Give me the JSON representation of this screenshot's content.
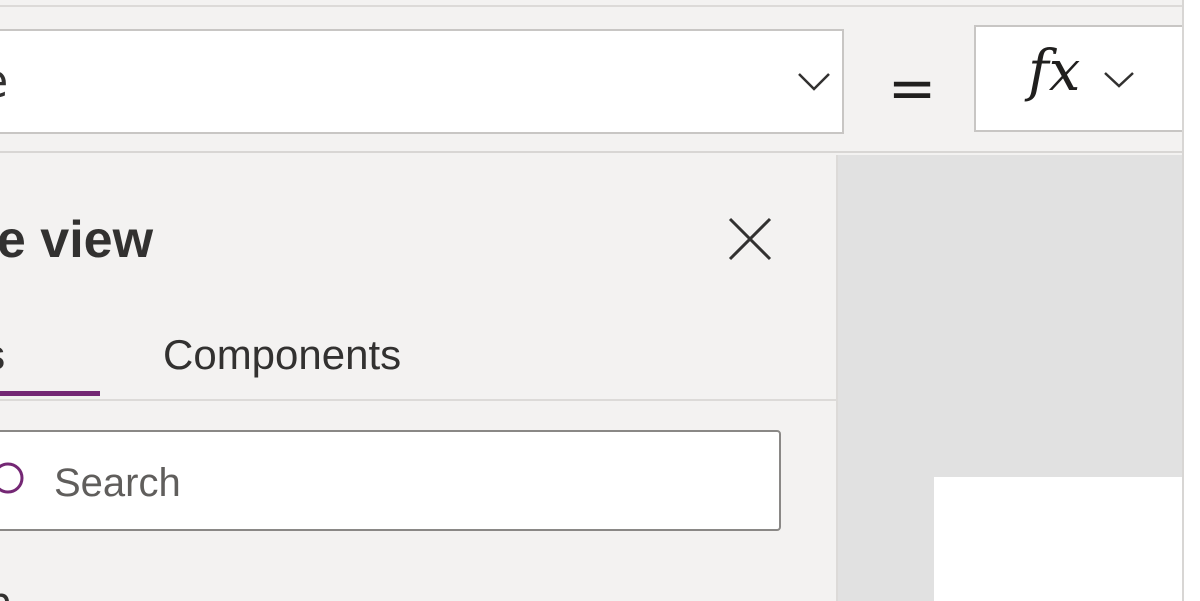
{
  "formula_bar": {
    "property_value": "e",
    "equals": "=",
    "fx_label": "fx",
    "dropdown_icon": "chevron-down-icon",
    "fx_icon": "chevron-down-icon"
  },
  "tree_view": {
    "title": "ee view",
    "close_icon": "close-icon",
    "tabs": [
      {
        "label": "eens",
        "selected": true
      },
      {
        "label": "Components",
        "selected": false
      }
    ],
    "search": {
      "placeholder": "Search",
      "value": "",
      "icon": "search-icon"
    },
    "list_partial": "n"
  },
  "colors": {
    "accent": "#742774",
    "pane_bg": "#f3f2f1",
    "canvas_bg": "#e1e1e1",
    "text": "#323130"
  }
}
